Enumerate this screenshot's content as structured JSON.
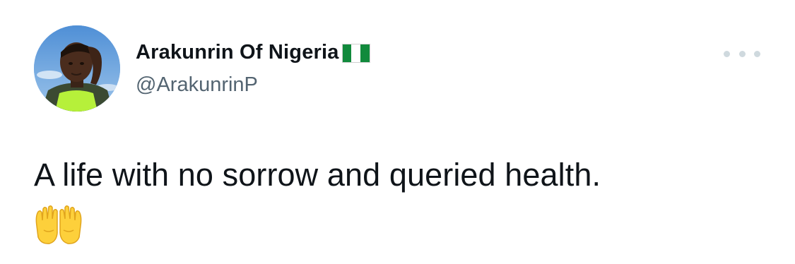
{
  "tweet": {
    "display_name": "Arakunrin Of Nigeria",
    "flag_icon": "nigeria-flag-emoji",
    "handle": "@ArakunrinP",
    "text": "A life with no sorrow and queried health.",
    "emoji_icon": "palms-up-together-emoji",
    "more_icon": "ellipsis-icon"
  },
  "colors": {
    "primary_text": "#0f1419",
    "secondary_text": "#536471",
    "more_dots": "#cfd9de",
    "flag_green": "#118a3c",
    "emoji_yellow": "#fdd03b"
  }
}
